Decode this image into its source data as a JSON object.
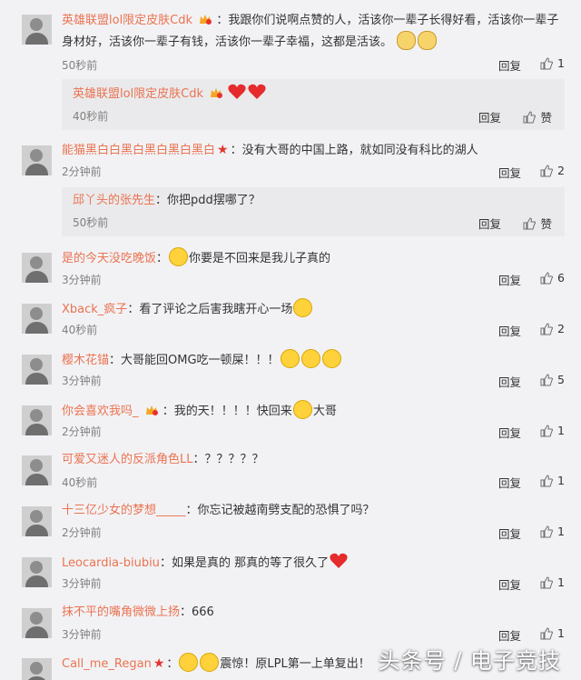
{
  "comments": [
    {
      "user": "英雄联盟lol限定皮肤Cdk",
      "text": "：我跟你们说啊点赞的人，活该你一辈子长得好看，活该你一辈子身材好，活该你一辈子有钱，活该你一辈子幸福，这都是活该。",
      "time": "50秒前",
      "reply": "回复",
      "likes": "1"
    },
    {
      "user": "能猫黑白白黑白黑白黑白黑白",
      "text": "：没有大哥的中国上路，就如同没有科比的湖人",
      "time": "2分钟前",
      "reply": "回复",
      "likes": "2"
    },
    {
      "user": "是的今天没吃晚饭",
      "text": "你要是不回来是我儿子真的",
      "time": "3分钟前",
      "reply": "回复",
      "likes": "6"
    },
    {
      "user": "Xback_疯子",
      "text": "：看了评论之后害我瞎开心一场",
      "time": "40秒前",
      "reply": "回复",
      "likes": "2"
    },
    {
      "user": "樱木花锚",
      "text": "：大哥能回OMG吃一顿屎！！！",
      "time": "3分钟前",
      "reply": "回复",
      "likes": "5"
    },
    {
      "user": "你会喜欢我吗_",
      "text": "：我的天！！！！快回来",
      "text2": "大哥",
      "time": "2分钟前",
      "reply": "回复",
      "likes": "1"
    },
    {
      "user": "可爱又迷人的反派角色LL",
      "text": "：？？？？？",
      "time": "40秒前",
      "reply": "回复",
      "likes": "1"
    },
    {
      "user": "十三亿少女的梦想_____",
      "text": "：你忘记被越南劈支配的恐惧了吗？",
      "time": "2分钟前",
      "reply": "回复",
      "likes": "1"
    },
    {
      "user": "Leocardia-biubiu",
      "text": "：如果是真的 那真的等了很久了",
      "time": "3分钟前",
      "reply": "回复",
      "likes": "1"
    },
    {
      "user": "抹不平的嘴角微微上扬",
      "text": "：666",
      "time": "3分钟前",
      "reply": "回复",
      "likes": "1"
    },
    {
      "user": "Call_me_Regan",
      "text": "震惊！原LPL第一上单复出！",
      "time": "",
      "reply": "",
      "likes": ""
    }
  ],
  "subreplies": [
    {
      "user": "英雄联盟lol限定皮肤Cdk",
      "text": "",
      "time": "40秒前",
      "reply": "回复",
      "likes": "赞"
    },
    {
      "user": "邱丫头的张先生",
      "text": "：你把pdd摆哪了？",
      "time": "50秒前",
      "reply": "回复",
      "likes": "赞"
    }
  ],
  "watermark": "头条号 / 电子竞技",
  "colors": {
    "username": "#eb7350",
    "subreply_bg": "#eaeaec",
    "page_bg": "#f2f2f5"
  }
}
